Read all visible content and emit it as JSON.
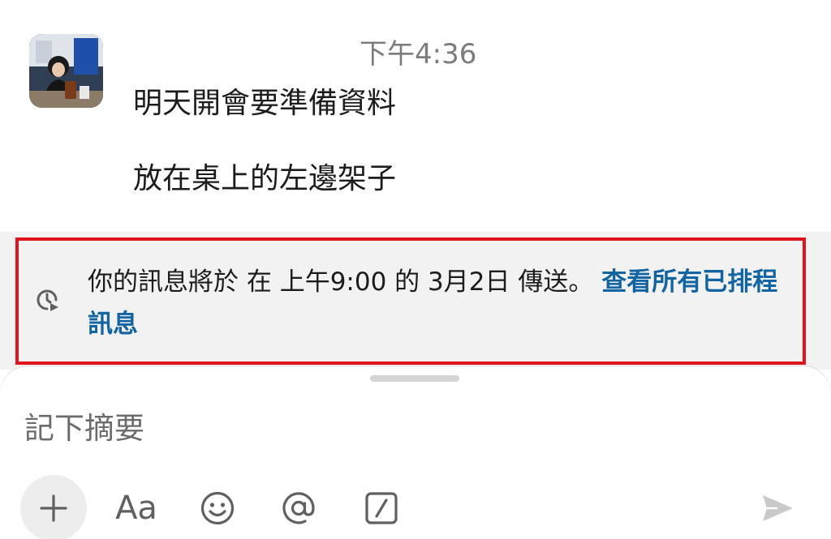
{
  "message": {
    "timestamp": "下午4:36",
    "lines": [
      "明天開會要準備資料",
      "放在桌上的左邊架子"
    ]
  },
  "scheduled_banner": {
    "text": "你的訊息將於 在 上午9:00 的 3月2日 傳送。",
    "link_label": "查看所有已排程訊息",
    "icon": "clock-schedule-icon",
    "link_color": "#1264a3",
    "highlight_border_color": "#e0131f"
  },
  "composer": {
    "placeholder": "記下摘要",
    "value": "",
    "toolbar": {
      "plus_icon": "plus-icon",
      "format_label": "Aa",
      "emoji_icon": "emoji-icon",
      "mention_icon": "at-icon",
      "shortcut_icon": "slash-command-icon",
      "send_icon": "send-icon"
    }
  }
}
